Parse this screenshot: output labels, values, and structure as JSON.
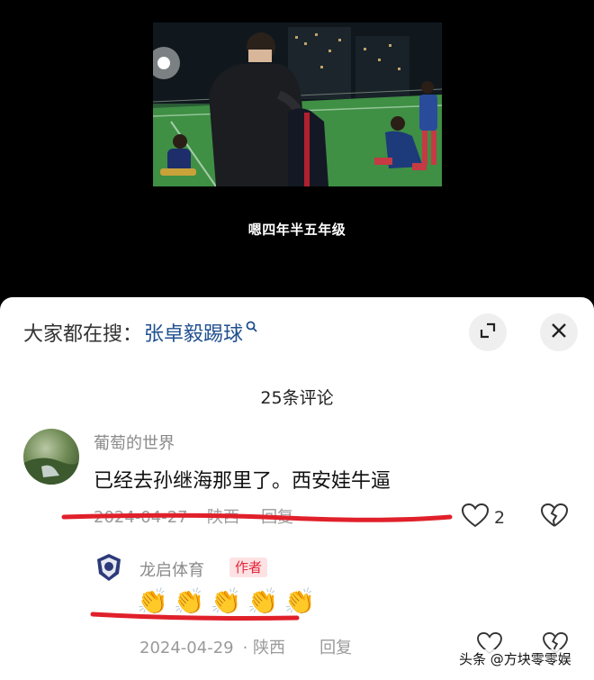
{
  "video": {
    "subtitle": "嗯四年半五年级"
  },
  "search": {
    "prefix": "大家都在搜：",
    "query": "张卓毅踢球",
    "icon": "search-icon"
  },
  "buttons": {
    "expand_icon": "expand-icon",
    "close_icon": "close-icon"
  },
  "comments_header": {
    "count_label": "25条评论"
  },
  "comments": [
    {
      "user": "葡萄的世界",
      "text": "已经去孙继海那里了。西安娃牛逼",
      "date": "2024-04-27",
      "location": "· 陕西",
      "reply_label": "回复",
      "like_count": "2"
    }
  ],
  "reply": {
    "user": "龙启体育",
    "badge": "作者",
    "emoji": [
      "👏",
      "👏",
      "👏",
      "👏",
      "👏"
    ],
    "date": "2024-04-29",
    "location": "· 陕西",
    "reply_label": "回复"
  },
  "watermark": "头条 @方块零零娱",
  "colors": {
    "link": "#1f4f8f",
    "badge_text": "#e0283a",
    "badge_bg": "#fde2e4",
    "underline": "#e0202a"
  }
}
